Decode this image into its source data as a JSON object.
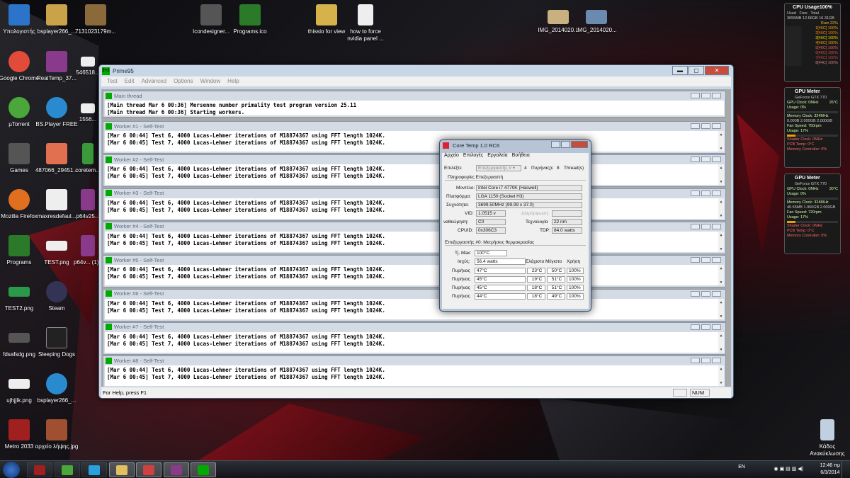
{
  "desktop_icons": [
    {
      "label": "Υπολογιστής",
      "color": "#2c74c9"
    },
    {
      "label": "bsplayer266_...",
      "color": "#c9a24a"
    },
    {
      "label": "7131023179m...",
      "color": "#8a6a3a"
    },
    {
      "label": "Icondesigner...",
      "color": "#555"
    },
    {
      "label": "Programs.ico",
      "color": "#2a7a2a"
    },
    {
      "label": "thissio for view",
      "color": "#d6b24a"
    },
    {
      "label": "how to force nvidia panel ...",
      "color": "#eee"
    },
    {
      "label": "IMG_2014020...",
      "color": "#c8b080"
    },
    {
      "label": "IMG_2014020...",
      "color": "#6a8ab0"
    },
    {
      "label": "Google Chrome",
      "color": "#e24b3a"
    },
    {
      "label": "RealTemp_37...",
      "color": "#8a3a8a"
    },
    {
      "label": "546518...",
      "color": "#eee"
    },
    {
      "label": "µTorrent",
      "color": "#4aa83a"
    },
    {
      "label": "BS.Player FREE",
      "color": "#2a8ad0"
    },
    {
      "label": "1556...",
      "color": "#eee"
    },
    {
      "label": "Games",
      "color": "#555"
    },
    {
      "label": "487066_29451...",
      "color": "#e07050"
    },
    {
      "label": "coretem...",
      "color": "#3a9a3a"
    },
    {
      "label": "Mozilla Firefox",
      "color": "#e07020"
    },
    {
      "label": "maxresdefaul...",
      "color": "#eee"
    },
    {
      "label": "p64v25...",
      "color": "#8a3a8a"
    },
    {
      "label": "Programs",
      "color": "#2a7a2a"
    },
    {
      "label": "TEST.png",
      "color": "#eee"
    },
    {
      "label": "p64v... (1)...",
      "color": "#8a3a8a"
    },
    {
      "label": "TEST2.png",
      "color": "#2a9a4a"
    },
    {
      "label": "Steam",
      "color": "#335"
    },
    {
      "label": "fdsafsdg.png",
      "color": "#555"
    },
    {
      "label": "Sleeping Dogs",
      "color": "#222"
    },
    {
      "label": "ujhjjlk.png",
      "color": "#eee"
    },
    {
      "label": "bsplayer266_...",
      "color": "#2a8ad0"
    },
    {
      "label": "Metro 2033",
      "color": "#a02020"
    },
    {
      "label": "αρχείο λήψης.jpg",
      "color": "#a05030"
    },
    {
      "label": "Κάδος Ανακύκλωσης",
      "color": "#c0d0e0"
    }
  ],
  "prime95": {
    "title": "Prime95",
    "logo": "2+1",
    "menu": [
      "Test",
      "Edit",
      "Advanced",
      "Options",
      "Window",
      "Help"
    ],
    "main_thread": {
      "title": "Main thread",
      "lines": [
        "[Main thread Mar 6 00:36] Mersenne number primality test program version 25.11",
        "[Main thread Mar 6 00:36] Starting workers."
      ]
    },
    "workers": [
      {
        "title": "Worker #1 - Self-Test"
      },
      {
        "title": "Worker #2 - Self-Test"
      },
      {
        "title": "Worker #3 - Self-Test"
      },
      {
        "title": "Worker #4 - Self-Test"
      },
      {
        "title": "Worker #5 - Self-Test"
      },
      {
        "title": "Worker #6 - Self-Test"
      },
      {
        "title": "Worker #7 - Self-Test"
      },
      {
        "title": "Worker #8 - Self-Test"
      }
    ],
    "worker_line_1": "[Mar 6 00:44] Test 6, 4000 Lucas-Lehmer iterations of M18874367 using FFT length 1024K.",
    "worker_line_2": "[Mar 6 00:45] Test 7, 4000 Lucas-Lehmer iterations of M18874367 using FFT length 1024K.",
    "status_text": "For Help, press F1",
    "status_num": "NUM"
  },
  "coretemp": {
    "title": "Core Temp 1.0 RC6",
    "menu": [
      "Αρχείο",
      "Επιλογές",
      "Εργαλεία",
      "Βοήθεια"
    ],
    "select_label": "Επιλέξτε",
    "select_value": "Επεξεργαστής #",
    "cores_count": "4",
    "cores_label": "Πυρήνας(ε",
    "threads_count": "8",
    "threads_label": "Thread(s)",
    "info_section": "Πληροφορίες Επεξεργαστή",
    "model_label": "Μοντέλο:",
    "model_value": "Intel Core i7 4770K (Haswell)",
    "platform_label": "Πλατφόρμα:",
    "platform_value": "LGA 1150 (Socket H3)",
    "freq_label": "Συχνότητα:",
    "freq_value": "3699.50MHz (99.99 x 37.0)",
    "vid_label": "VID:",
    "vid_value": "1.0515 v",
    "mod_label": "Διαμόρφωση:",
    "rev_label": "ναθεώρηση:",
    "rev_value": "C0",
    "tech_label": "Τεχνολογία",
    "tech_value": "22 nm",
    "cpuid_label": "CPUID:",
    "cpuid_value": "0x306C3",
    "tdp_label": "TDP:",
    "tdp_value": "84.0 watts",
    "temp_section": "Επεξεργαστής #0: Μετρήσεις θερμοκρασίας",
    "tjmax_label": "Tj. Max:",
    "tjmax_value": "100°C",
    "power_label": "Ισχύς:",
    "power_value": "56.4 watts",
    "col_min": "Ελάχιστο",
    "col_max": "Μέγιστο",
    "col_load": "Χρήση",
    "cores": [
      {
        "label": "Πυρήνας",
        "temp": "47°C",
        "min": "23°C",
        "max": "50°C",
        "load": "100%"
      },
      {
        "label": "Πυρήνας",
        "temp": "45°C",
        "min": "19°C",
        "max": "51°C",
        "load": "100%"
      },
      {
        "label": "Πυρήνας",
        "temp": "45°C",
        "min": "18°C",
        "max": "51°C",
        "load": "100%"
      },
      {
        "label": "Πυρήνας",
        "temp": "44°C",
        "min": "18°C",
        "max": "49°C",
        "load": "100%"
      }
    ]
  },
  "gadgets": {
    "cpu": {
      "title": "CPU Usage100%",
      "used": "Used",
      "free": "Free",
      "total": "Total",
      "mem": "3655MB 12.66GB 16.31GB",
      "ram": "Ram 22%",
      "cores": [
        "1[46C] 100%",
        "2[46C] 100%",
        "3[46C] 100%",
        "4[46C] 100%",
        "5[46C] 100%",
        "6[46C] 100%",
        "7[46C] 100%",
        "8[44C] 100%"
      ]
    },
    "gpu1": {
      "title": "GPU Meter",
      "model": "GeForce GTX 770",
      "clock": "GPU Clock: 0MHz",
      "temp": "26°C",
      "usage": "Usage: 0%",
      "memclock": "Memory Clock: 324MHz",
      "mem": "0.000B 2.000GB 2.000GB",
      "fan": "Fan Speed: 750rpm",
      "fanusage": "Usage: 17%",
      "shader": "Shader Clock: 0MHz",
      "pcb": "PCB Temp: 0°C",
      "mc": "Memory Controller: 0%"
    },
    "gpu2": {
      "title": "GPU Meter",
      "model": "GeForce GTX 770",
      "clock": "GPU Clock: 0MHz",
      "temp": "30°C",
      "usage": "Usage: 0%",
      "memclock": "Memory Clock: 324MHz",
      "mem": "40.55MB 1.960GB 2.000GB",
      "fan": "Fan Speed: 720rpm",
      "fanusage": "Usage: 17%",
      "shader": "Shader Clock: 0MHz",
      "pcb": "PCB Temp: 0°C",
      "mc": "Memory Controller: 0%"
    }
  },
  "taskbar": {
    "apps": [
      {
        "name": "metro",
        "color": "#a02020"
      },
      {
        "name": "utorrent",
        "color": "#4aa83a"
      },
      {
        "name": "skype",
        "color": "#2aa0e0"
      },
      {
        "name": "explorer",
        "color": "#e0c060"
      },
      {
        "name": "coretemp",
        "color": "#d04040"
      },
      {
        "name": "winrar",
        "color": "#8a3a8a"
      },
      {
        "name": "prime95",
        "color": "#0a0"
      }
    ],
    "lang": "EN",
    "time": "12:46 πμ",
    "date": "6/3/2014"
  }
}
